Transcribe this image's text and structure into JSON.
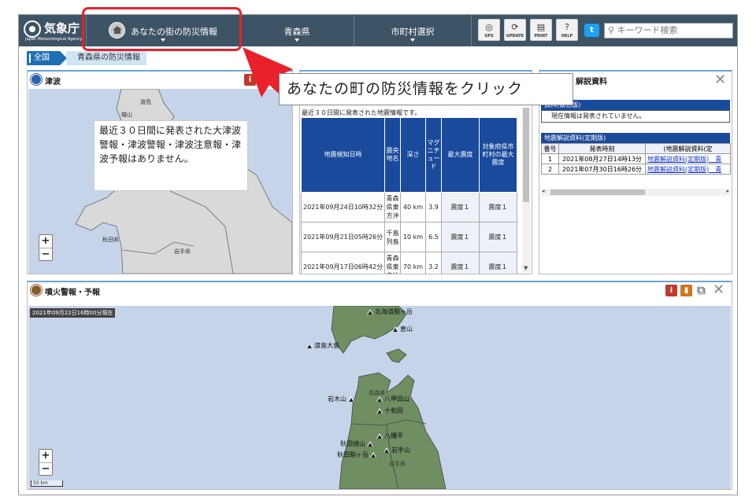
{
  "header": {
    "logo_text": "気象庁",
    "logo_sub": "Japan Meteorological Agency",
    "nav": [
      {
        "label": "あなたの街の防災情報"
      },
      {
        "label": "青森県"
      },
      {
        "label": "市町村選択"
      }
    ],
    "tools": [
      {
        "icon": "gps-icon",
        "label": "GPS"
      },
      {
        "icon": "update-icon",
        "label": "UPDATE"
      },
      {
        "icon": "print-icon",
        "label": "PRINT"
      },
      {
        "icon": "help-icon",
        "label": "HELP"
      }
    ],
    "search_placeholder": "キーワード検索"
  },
  "breadcrumb": {
    "all": "全国",
    "pref": "青森県の防災情報"
  },
  "tsunami": {
    "title": "津波",
    "message": "最近３０日間に発表された大津波警報・津波警報・津波注意報・津波予報はありません。",
    "labels": {
      "a": "渡島",
      "b": "檜山",
      "c": "秋田県",
      "d": "岩手県"
    }
  },
  "quake": {
    "caption": "最近３０日間に発表された地震情報です。",
    "headers": {
      "date": "地震検知日時",
      "epicenter": "震央地名",
      "depth": "深さ",
      "magnitude": "マグニチュード",
      "max": "最大震度",
      "local": "対象府県市町村の最大震度"
    },
    "rows": [
      {
        "date": "2021年09月24日10時32分",
        "epicenter": "青森県東方沖",
        "depth": "40 km",
        "magnitude": "3.9",
        "max": "震度１",
        "local": "震度１"
      },
      {
        "date": "2021年09月21日05時26分",
        "epicenter": "千島列島",
        "depth": "10 km",
        "magnitude": "6.5",
        "max": "震度１",
        "local": "震度１"
      },
      {
        "date": "2021年09月17日06時42分",
        "epicenter": "青森県東方沖",
        "depth": "70 km",
        "magnitude": "3.2",
        "max": "震度１",
        "local": "震度１"
      }
    ]
  },
  "commentary": {
    "title": "解説資料",
    "urgent_title": "資料(緊急版)",
    "urgent_msg": "現在情報は発表されていません。",
    "regular_title": "地震解説資料(定期版)",
    "headers": {
      "no": "番号",
      "time": "発表時刻",
      "doc": "(地震解説資料(定"
    },
    "rows": [
      {
        "no": "1",
        "time": "2021年08月27日14時13分",
        "doc": "地震解説資料(定期版)　青"
      },
      {
        "no": "2",
        "time": "2021年07月30日16時26分",
        "doc": "地震解説資料(定期版)　青"
      }
    ]
  },
  "volcano": {
    "title": "噴火警報・予報",
    "timestamp": "2021年09月22日16時00分現在",
    "volcanoes": [
      {
        "name": "北海道駒ヶ岳"
      },
      {
        "name": "恵山"
      },
      {
        "name": "渡島大島"
      },
      {
        "name": "岩木山"
      },
      {
        "name": "八甲田山"
      },
      {
        "name": "十和田"
      },
      {
        "name": "八幡平"
      },
      {
        "name": "秋田焼山"
      },
      {
        "name": "岩手山"
      },
      {
        "name": "秋田駒ヶ岳"
      }
    ],
    "region_labels": {
      "a": "青森県",
      "b": "岩手県"
    },
    "scale": "50 km"
  },
  "callout": {
    "text": "あなたの町の防災情報をクリック"
  },
  "colors": {
    "header_bg": "#3d5366",
    "table_head": "#1a4a9c",
    "accent_red": "#e8212a",
    "land_green": "#6f8f63",
    "sea": "#c6d4ea"
  }
}
